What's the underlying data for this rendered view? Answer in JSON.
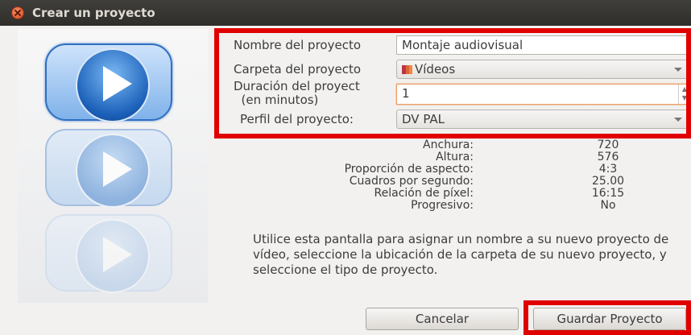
{
  "window": {
    "title": "Crear un proyecto"
  },
  "form": {
    "name_label": "Nombre del proyecto",
    "name_value": "Montaje audiovisual",
    "folder_label": "Carpeta del proyecto",
    "folder_value": "Vídeos",
    "duration_label_1": "Duración del proyect",
    "duration_label_2": "  (en minutos)",
    "duration_value": "1",
    "profile_label": "Perfil del proyecto:",
    "profile_value": "DV PAL"
  },
  "properties": [
    {
      "label": "Anchura:",
      "value": "720"
    },
    {
      "label": "Altura:",
      "value": "576"
    },
    {
      "label": "Proporción de aspecto:",
      "value": "4:3"
    },
    {
      "label": "Cuadros por segundo:",
      "value": "25.00"
    },
    {
      "label": "Relación de píxel:",
      "value": "16:15"
    },
    {
      "label": "Progresivo:",
      "value": "No"
    }
  ],
  "description": "Utilice esta pantalla para asignar un nombre a su nuevo proyecto de vídeo, seleccione la ubicación de la carpeta de su nuevo proyecto, y seleccione el tipo de proyecto.",
  "buttons": {
    "cancel": "Cancelar",
    "save": "Guardar Proyecto"
  },
  "colors": {
    "highlight": "#e00000",
    "titlebar": "#3c3b37",
    "accent": "#2f6fc2"
  }
}
